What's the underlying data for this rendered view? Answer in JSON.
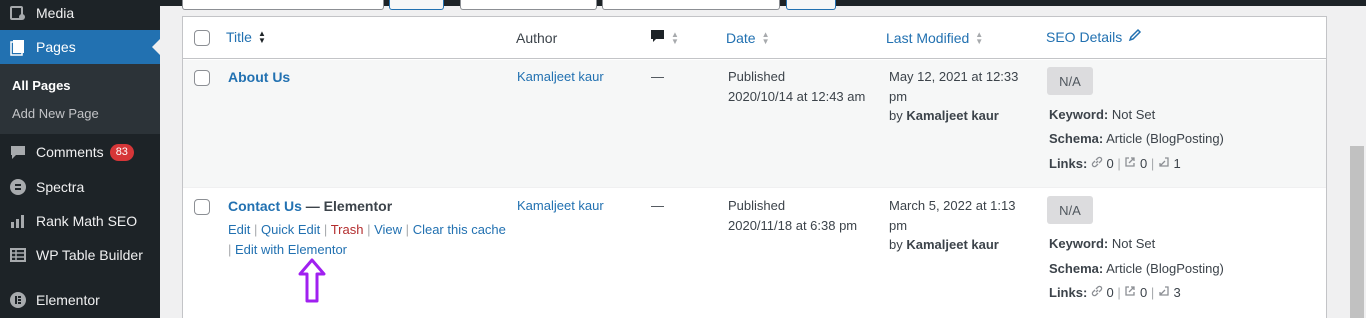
{
  "sidebar": {
    "items": [
      {
        "label": "Media",
        "icon": "media-icon"
      },
      {
        "label": "Pages",
        "icon": "pages-icon"
      },
      {
        "label": "Comments",
        "icon": "comments-icon",
        "badge": "83"
      },
      {
        "label": "Spectra",
        "icon": "spectra-icon"
      },
      {
        "label": "Rank Math SEO",
        "icon": "rank-math-icon"
      },
      {
        "label": "WP Table Builder",
        "icon": "table-builder-icon"
      },
      {
        "label": "Elementor",
        "icon": "elementor-icon"
      }
    ],
    "submenu": [
      {
        "label": "All Pages"
      },
      {
        "label": "Add New Page"
      }
    ]
  },
  "table": {
    "headers": {
      "title": "Title",
      "author": "Author",
      "date": "Date",
      "last_modified": "Last Modified",
      "seo_details": "SEO Details"
    },
    "rows": [
      {
        "title": "About Us",
        "state": "",
        "author": "Kamaljeet kaur",
        "comments": "—",
        "date_status": "Published",
        "date_value": "2020/10/14 at 12:43 am",
        "modified_1": "May 12, 2021 at 12:33",
        "modified_2": "pm",
        "modified_by": "by",
        "modified_user": "Kamaljeet kaur",
        "seo_score": "N/A",
        "keyword_label": "Keyword:",
        "keyword_value": "Not Set",
        "schema_label": "Schema:",
        "schema_value": "Article (BlogPosting)",
        "links_label": "Links:",
        "links_internal": "0",
        "links_external": "0",
        "links_incoming": "1"
      },
      {
        "title": "Contact Us",
        "state": " — Elementor",
        "author": "Kamaljeet kaur",
        "comments": "—",
        "date_status": "Published",
        "date_value": "2020/11/18 at 6:38 pm",
        "modified_1": "March 5, 2022 at 1:13",
        "modified_2": "pm",
        "modified_by": "by",
        "modified_user": "Kamaljeet kaur",
        "seo_score": "N/A",
        "keyword_label": "Keyword:",
        "keyword_value": "Not Set",
        "schema_label": "Schema:",
        "schema_value": "Article (BlogPosting)",
        "links_label": "Links:",
        "links_internal": "0",
        "links_external": "0",
        "links_incoming": "3",
        "actions": {
          "edit": "Edit",
          "quick_edit": "Quick Edit",
          "trash": "Trash",
          "view": "View",
          "clear_cache": "Clear this cache",
          "edit_elementor": "Edit with Elementor"
        }
      }
    ]
  },
  "separators": {
    "pipe": "|"
  },
  "colors": {
    "accent": "#2271b1",
    "sidebar": "#1d2327",
    "annotation_arrow": "#a020f0",
    "badge": "#d63638"
  }
}
